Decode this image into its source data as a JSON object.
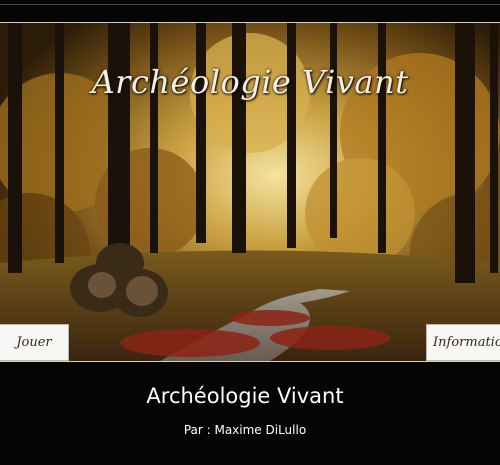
{
  "game": {
    "logo_title": "Archéologie Vivant",
    "buttons": {
      "play_label": "Jouer",
      "info_label": "Informations"
    }
  },
  "caption": {
    "title": "Archéologie Vivant",
    "author": "Par : Maxime DiLullo"
  },
  "colors": {
    "background": "#050505",
    "forest_canopy": "#b8862a",
    "path_leaves": "#8a2a18",
    "button_bg": "#f7f7f5",
    "caption_text": "#ffffff"
  }
}
